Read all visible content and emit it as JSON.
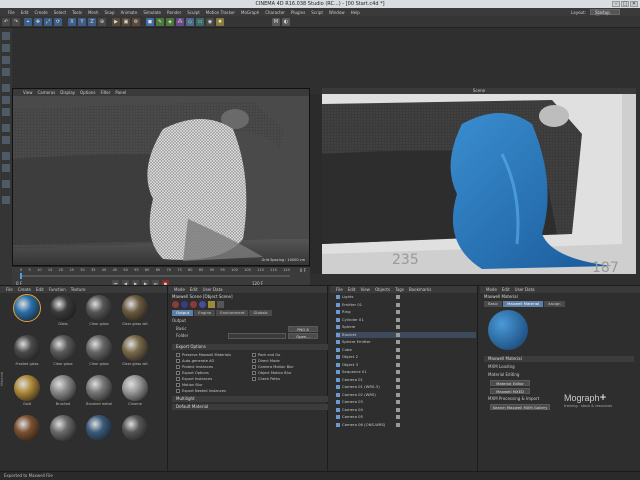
{
  "window": {
    "title": "CINEMA 4D R16.038 Studio (RC...) - [00 Start.c4d *]",
    "min": "–",
    "max": "□",
    "close": "✕"
  },
  "menu": [
    "File",
    "Edit",
    "Create",
    "Select",
    "Tools",
    "Mesh",
    "Snap",
    "Animate",
    "Simulate",
    "Render",
    "Sculpt",
    "Motion Tracker",
    "MoGraph",
    "Character",
    "Plugins",
    "Script",
    "Window",
    "Help"
  ],
  "layout": {
    "label": "Layout:",
    "value": "Startup (User)"
  },
  "viewport": {
    "menu": [
      "View",
      "Cameras",
      "Display",
      "Options",
      "Filter",
      "Panel"
    ],
    "name": "Perspective",
    "grid": "Grid Spacing : 10000 cm"
  },
  "render_view": {
    "title": "Scene"
  },
  "timeline": {
    "start": "0 F",
    "end": "120 F",
    "ticks": [
      "0",
      "5",
      "10",
      "15",
      "20",
      "25",
      "30",
      "35",
      "40",
      "45",
      "50",
      "55",
      "60",
      "65",
      "70",
      "75",
      "80",
      "85",
      "90",
      "95",
      "100",
      "105",
      "110",
      "115",
      "120"
    ],
    "frame": "0 F"
  },
  "materials": {
    "menu": [
      "File",
      "Create",
      "Edit",
      "Function",
      "Texture"
    ],
    "items": [
      {
        "label": "",
        "color": "#2a6fa8"
      },
      {
        "label": "Glass",
        "color": "#3a3a3a"
      },
      {
        "label": "Clear glass",
        "color": "#555"
      },
      {
        "label": "Clear glass with",
        "color": "#6a5a40"
      },
      {
        "label": "Frosted glass",
        "color": "#4a4a4a"
      },
      {
        "label": "Clear glass",
        "color": "#5a5a5a"
      },
      {
        "label": "Clear glass",
        "color": "#666"
      },
      {
        "label": "Clear glass with",
        "color": "#7a6a4a"
      },
      {
        "label": "Gold",
        "color": "#b08a3a"
      },
      {
        "label": "Brushed",
        "color": "#8a8a8a"
      },
      {
        "label": "Brushed metal",
        "color": "#777"
      },
      {
        "label": "Chrome",
        "color": "#999"
      },
      {
        "label": "",
        "color": "#7a5030"
      },
      {
        "label": "",
        "color": "#6a6a6a"
      },
      {
        "label": "",
        "color": "#3a5a7a"
      },
      {
        "label": "",
        "color": "#555"
      }
    ]
  },
  "attributes": {
    "menu": [
      "Mode",
      "Edit",
      "User Data"
    ],
    "title": "Maxwell Scene [Object Scene]",
    "tabs": [
      "Output",
      "Engine",
      "Environment",
      "Globals"
    ],
    "output_label": "Output",
    "fields": [
      {
        "label": "Basic",
        "value": "PNG 8"
      },
      {
        "label": "Folder",
        "value": ""
      }
    ],
    "open_button": "Open...",
    "sections": [
      "Export Options",
      "Multilight",
      "Default Material"
    ],
    "options_left": [
      "Preserve Maxwell Materials",
      "Auto-generate AO",
      "Protect Instances",
      "Export Options",
      "Export Instances",
      "Motion Blur",
      "Export Nested Instances"
    ],
    "options_right": [
      "Pack and Go",
      "Direct Mode",
      "Camera Motion Blur",
      "Object Motion Blur",
      "Check Paths"
    ],
    "check_paths": "Check Paths"
  },
  "objects": {
    "menu": [
      "File",
      "Edit",
      "View",
      "Objects",
      "Tags",
      "Bookmarks"
    ],
    "items": [
      "Lights",
      "Emitter 01",
      "Ring",
      "Cylinder 01",
      "Sphere",
      "Blanket",
      "Sphere Emitter",
      "Cube",
      "Object 2",
      "Object 3",
      "Sequence 01",
      "Camera 01",
      "Camera 01 (WRS-3)",
      "Camera 02 (WRS)",
      "Camera 03",
      "Camera 04",
      "Camera 05",
      "Camera 06 (ONS-WRS)"
    ]
  },
  "material_attr": {
    "menu": [
      "Mode",
      "Edit",
      "User Data"
    ],
    "title": "Maxwell Material",
    "tabs": [
      "Basic",
      "Maxwell Material",
      "Assign"
    ],
    "section": "Maxwell Material",
    "items": [
      "MXM Loading",
      "Material Editing",
      "Material Editor",
      "Maxwell MXED",
      "MXM Processing & Import",
      "Search Maxwell MXM Gallery"
    ]
  },
  "status": "Exported to Maxwell File",
  "brand": {
    "name": "Mograph",
    "suffix": "+",
    "sub": "training · stock & resources"
  },
  "side_label": "Material"
}
